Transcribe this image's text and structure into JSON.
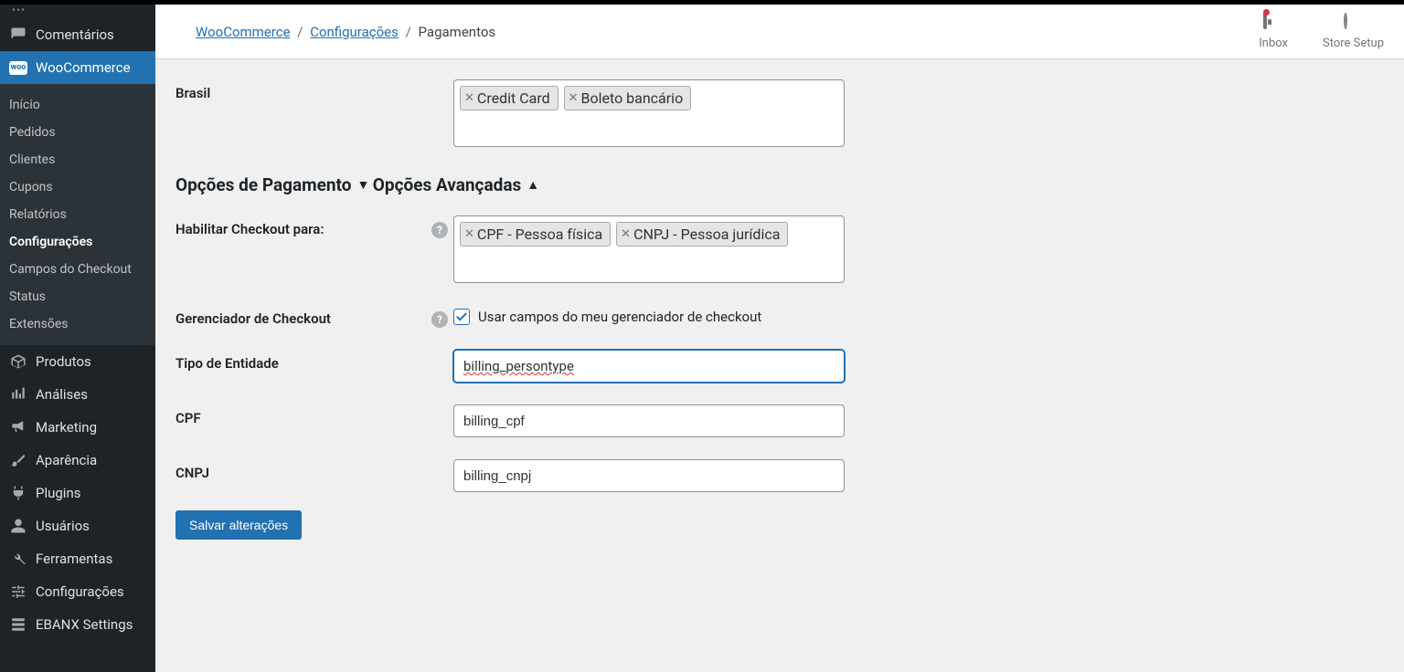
{
  "sidebar": {
    "items": [
      {
        "label": "Comentários"
      },
      {
        "label": "WooCommerce"
      },
      {
        "label": "Produtos"
      },
      {
        "label": "Análises"
      },
      {
        "label": "Marketing"
      },
      {
        "label": "Aparência"
      },
      {
        "label": "Plugins"
      },
      {
        "label": "Usuários"
      },
      {
        "label": "Ferramentas"
      },
      {
        "label": "Configurações"
      },
      {
        "label": "EBANX Settings"
      }
    ],
    "sub": [
      "Início",
      "Pedidos",
      "Clientes",
      "Cupons",
      "Relatórios",
      "Configurações",
      "Campos do Checkout",
      "Status",
      "Extensões"
    ]
  },
  "header": {
    "crumb1": "WooCommerce",
    "crumb2": "Configurações",
    "crumb3": "Pagamentos",
    "sep": "/",
    "inbox": "Inbox",
    "store_setup": "Store Setup"
  },
  "form": {
    "brasil_label": "Brasil",
    "brasil_tags": [
      "Credit Card",
      "Boleto bancário"
    ],
    "sec_payment": "Opções de Pagamento",
    "sec_advanced": "Opções Avançadas",
    "checkout_for_label": "Habilitar Checkout para:",
    "checkout_for_tags": [
      "CPF - Pessoa física",
      "CNPJ - Pessoa jurídica"
    ],
    "checkout_mgr_label": "Gerenciador de Checkout",
    "checkout_mgr_text": "Usar campos do meu gerenciador de checkout",
    "entity_type_label": "Tipo de Entidade",
    "entity_type_value": "billing_persontype",
    "cpf_label": "CPF",
    "cpf_value": "billing_cpf",
    "cnpj_label": "CNPJ",
    "cnpj_value": "billing_cnpj",
    "save_btn": "Salvar alterações"
  }
}
